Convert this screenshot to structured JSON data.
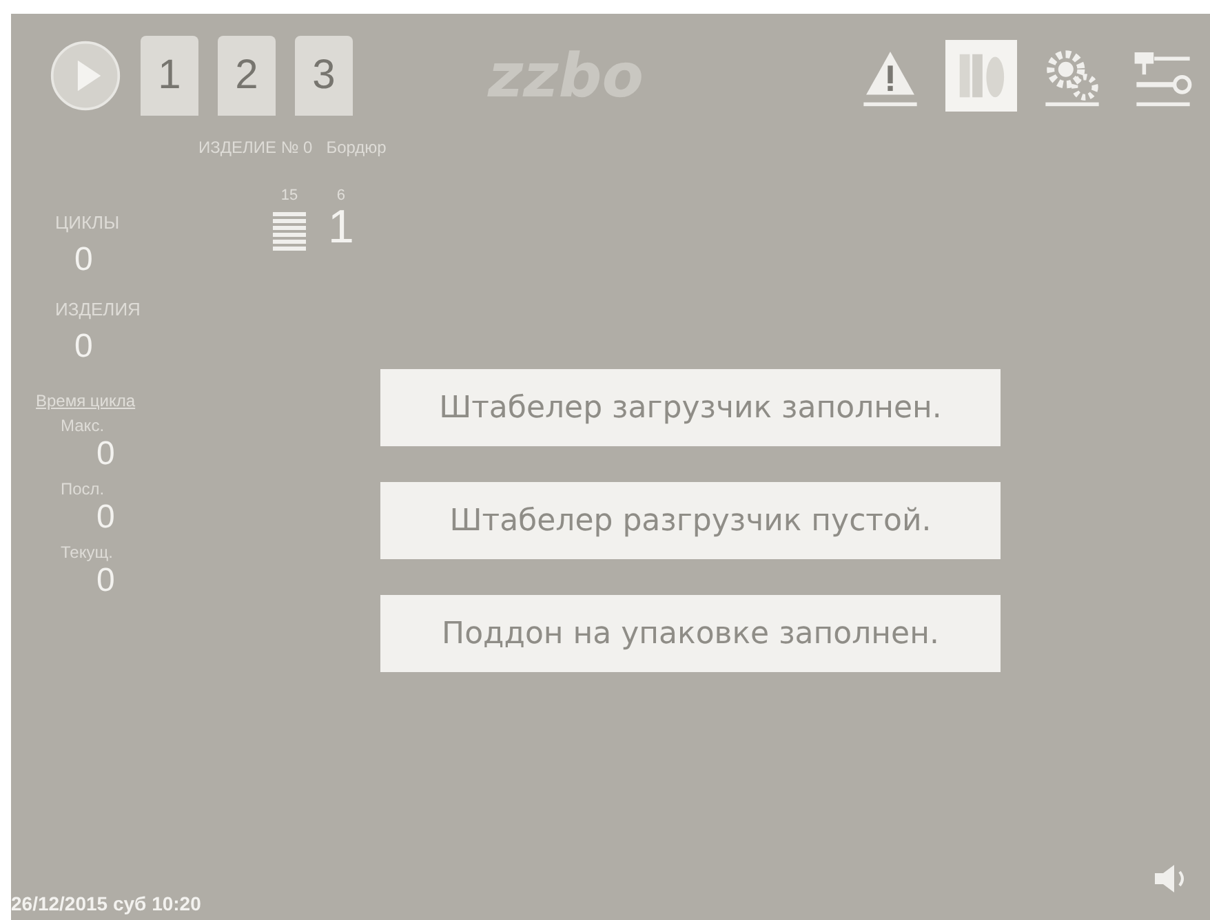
{
  "toolbar": {
    "programs": [
      {
        "label": "1"
      },
      {
        "label": "2"
      },
      {
        "label": "3"
      }
    ],
    "logo": "zzbo",
    "tools": [
      {
        "kind": "warning",
        "selected": false
      },
      {
        "kind": "books",
        "selected": true
      },
      {
        "kind": "gears",
        "selected": false
      },
      {
        "kind": "tools",
        "selected": false
      }
    ]
  },
  "product": {
    "label": "ИЗДЕЛИЕ № 0",
    "name": "Бордюр"
  },
  "counters": [
    {
      "label": "ЦИКЛЫ",
      "value": "0"
    },
    {
      "label": "ИЗДЕЛИЯ",
      "value": "0"
    }
  ],
  "cycle_time": {
    "title": "Время цикла",
    "items": [
      {
        "label": "Макс.",
        "value": "0"
      },
      {
        "label": "Посл.",
        "value": "0"
      },
      {
        "label": "Текущ.",
        "value": "0"
      }
    ]
  },
  "stack": {
    "total": "15",
    "layer": "6",
    "value": "1"
  },
  "messages": [
    "Штабелер загрузчик заполнен.",
    "Штабелер разгрузчик пустой.",
    "Поддон на упаковке заполнен."
  ],
  "status": {
    "datetime": "26/12/2015 суб 10:20"
  }
}
